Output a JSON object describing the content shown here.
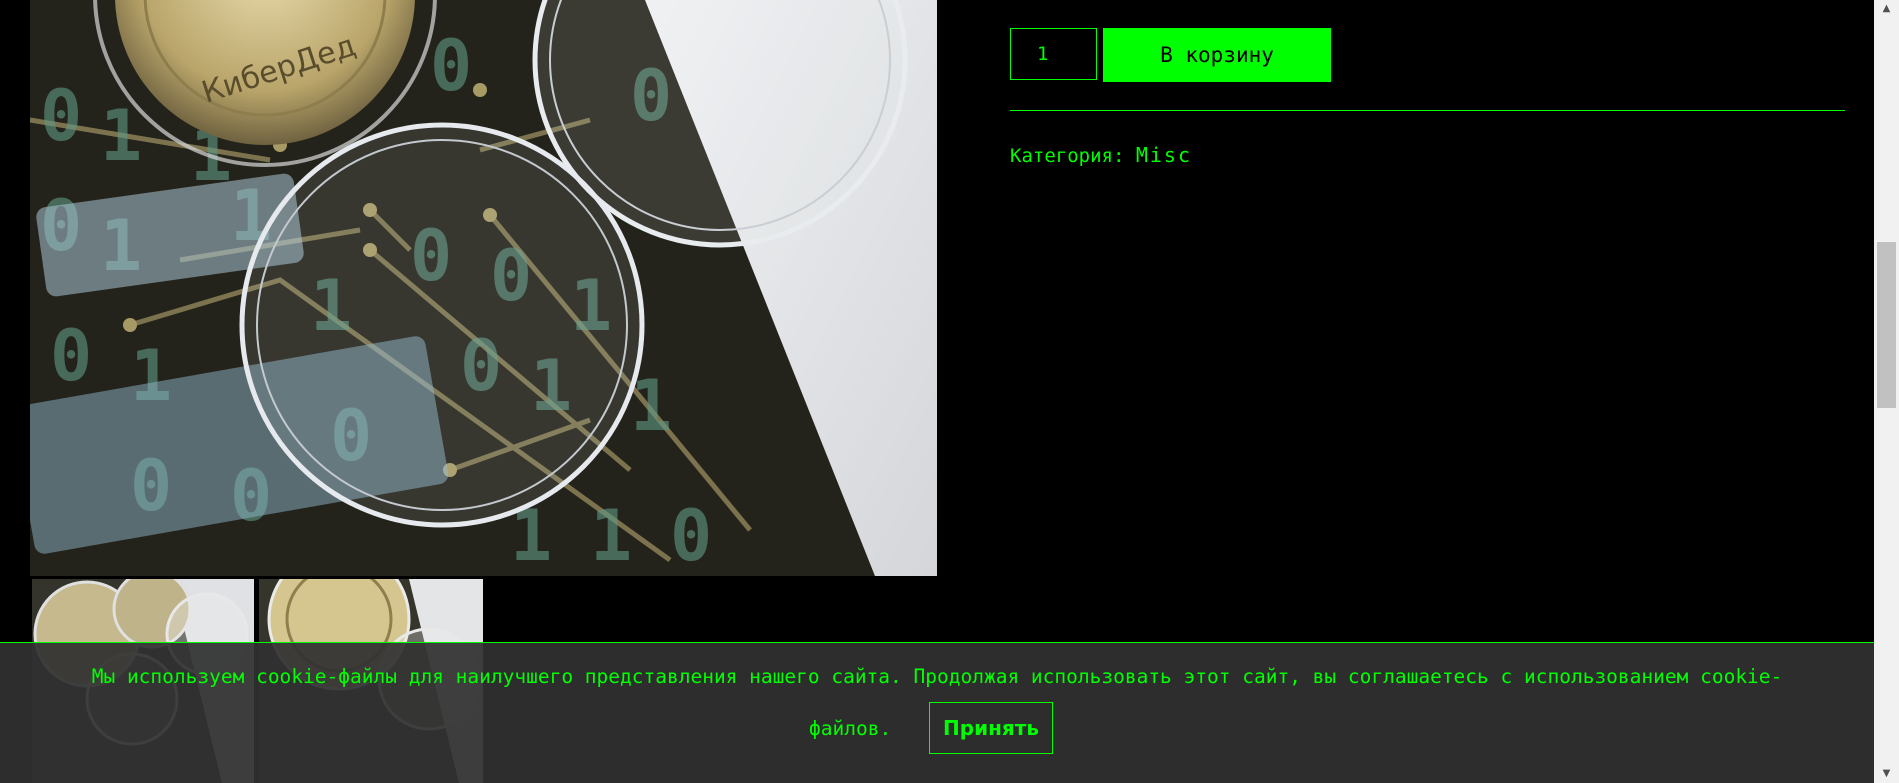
{
  "product": {
    "quantity": "1",
    "add_to_cart_label": "В корзину",
    "category_label": "Категория:",
    "category_value": "Misc",
    "coin_engraving": "КиберДед"
  },
  "gallery": {
    "main_image_icon": "product-photo",
    "thumbnails": [
      "thumbnail-1",
      "thumbnail-2"
    ]
  },
  "cookie_banner": {
    "text_line1": "Мы используем cookie-файлы для наилучшего представления нашего сайта. Продолжая использовать этот сайт, вы соглашаетесь с использованием cookie-",
    "text_line2": "файлов.",
    "accept_label": "Принять"
  },
  "colors": {
    "accent": "#00ff00",
    "background": "#000000",
    "banner": "#303030"
  }
}
